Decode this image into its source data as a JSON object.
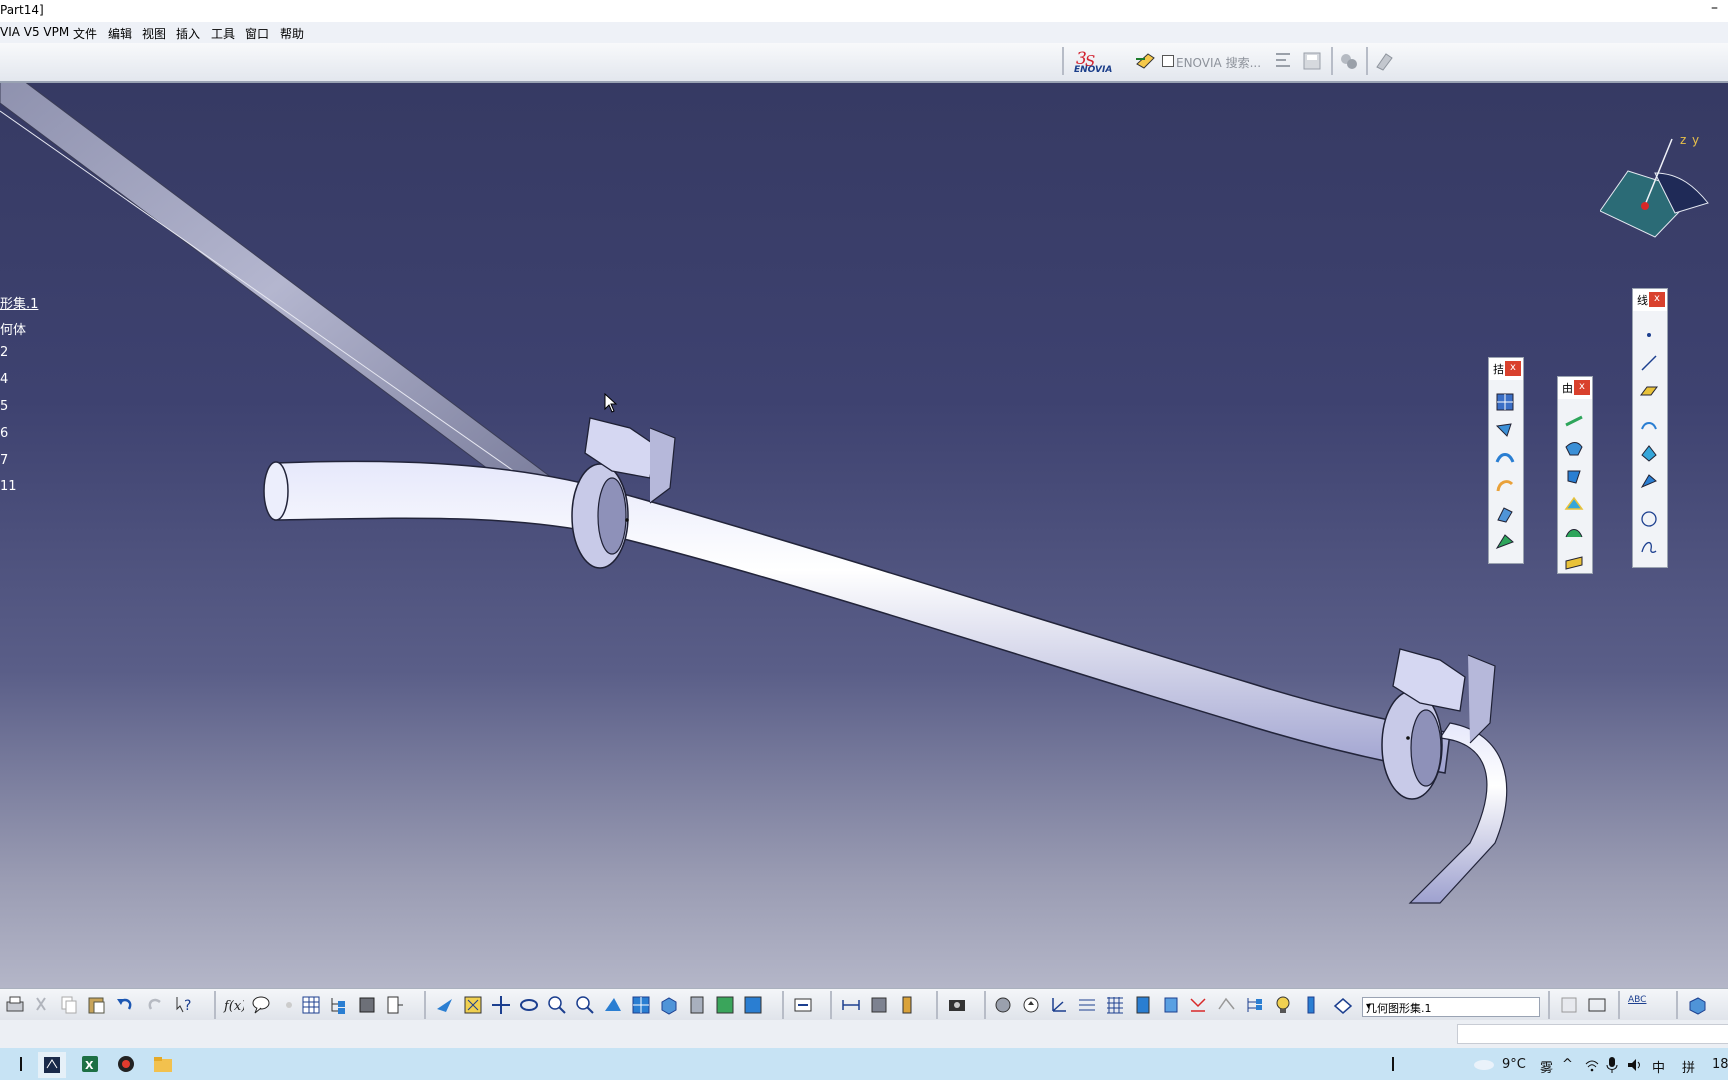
{
  "window": {
    "title": "Part14]",
    "minimize_glyph": "–"
  },
  "menu": [
    "VIA V5 VPM",
    "文件",
    "编辑",
    "视图",
    "插入",
    "工具",
    "窗口",
    "帮助"
  ],
  "top_toolbar": {
    "enovia_logo_text": "ENOVIA",
    "enovia_search_label": "ENOVIA 搜索..."
  },
  "spec_tree": {
    "root": "形集.1",
    "items": [
      "何体",
      "2",
      "4",
      "5",
      "6",
      "7",
      "11"
    ]
  },
  "compass": {
    "axis_z": "z",
    "axis_y": "y"
  },
  "floating_toolbars": [
    {
      "caption": "拮",
      "close": "x"
    },
    {
      "caption": "由",
      "close": "x"
    },
    {
      "caption": "线",
      "close": "x"
    }
  ],
  "bottom_toolbar": {
    "current_body": "几何图形集.1",
    "abc_label": "ABC"
  },
  "taskbar": {
    "weather_temp": "9°C",
    "weather_desc": "雾",
    "ime_lang": "中",
    "ime_mode": "拼",
    "clock": "18"
  }
}
